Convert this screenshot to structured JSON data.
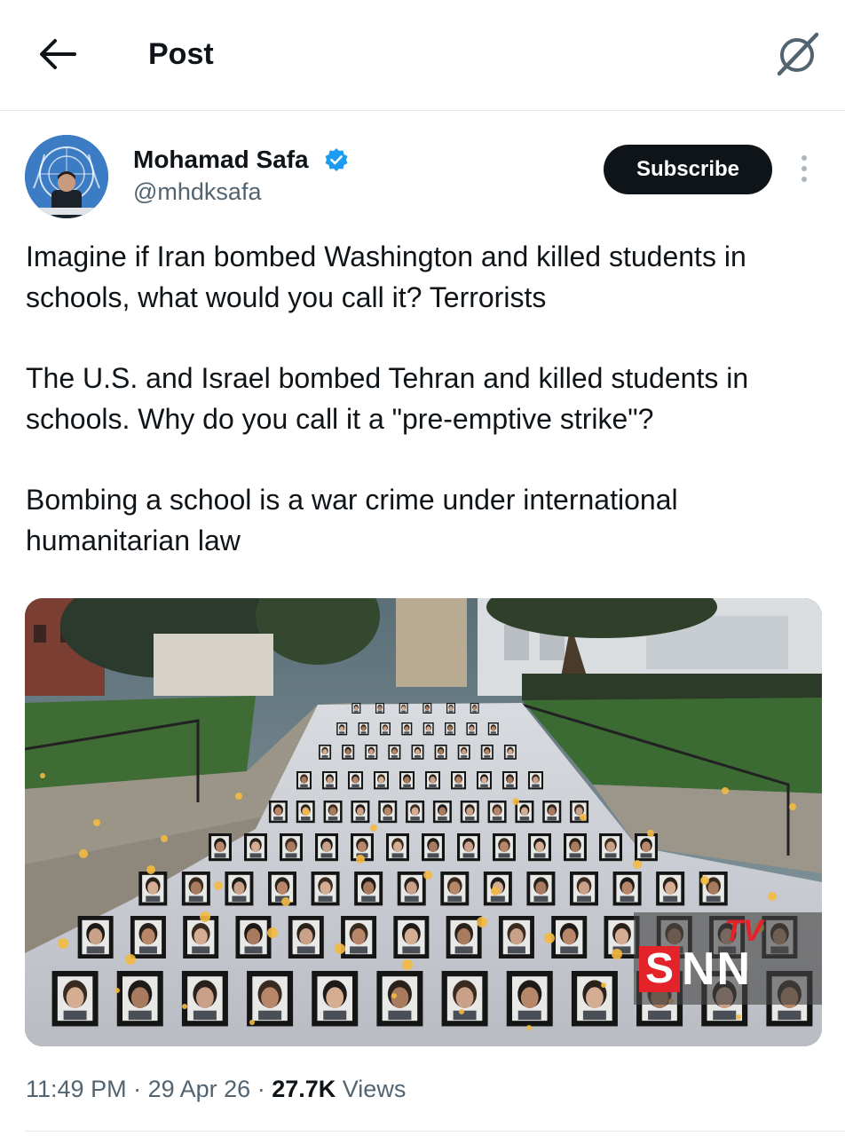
{
  "header": {
    "title": "Post",
    "back_icon": "arrow-left-icon",
    "grok_icon": "grok-slash-icon"
  },
  "author": {
    "name": "Mohamad Safa",
    "handle": "@mhdksafa",
    "verified": true,
    "verified_color": "#1d9bf0"
  },
  "actions": {
    "subscribe_label": "Subscribe",
    "more_icon": "more-vertical-icon"
  },
  "post": {
    "paragraphs": [
      "Imagine if Iran bombed Washington and killed students in schools, what would you call it? Terrorists",
      "The U.S. and Israel bombed Tehran and killed students in schools. Why do you call it a \"pre-emptive strike\"?",
      "Bombing a school is a war crime under international humanitarian law"
    ]
  },
  "media": {
    "watermark": {
      "tv": "TV",
      "s": "S",
      "nn": "NN",
      "brand_color": "#e3222a"
    }
  },
  "meta": {
    "time": "11:49 PM",
    "date": "29 Apr 26",
    "views_count": "27.7K",
    "views_label": "Views"
  },
  "colors": {
    "text": "#0f1419",
    "secondary": "#536471",
    "divider": "#e6e9ec"
  }
}
